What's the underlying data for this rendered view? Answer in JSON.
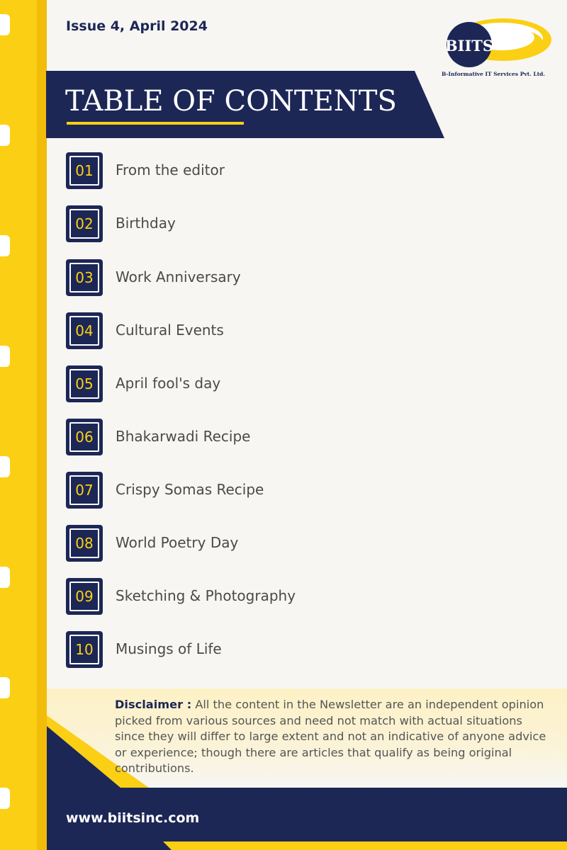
{
  "header": {
    "issue": "Issue 4, April 2024",
    "logo_text": "BIITS",
    "logo_tagline": "B-Informative IT Services Pvt. Ltd."
  },
  "banner": {
    "title": "TABLE OF CONTENTS"
  },
  "toc": [
    {
      "num": "01",
      "label": "From the editor"
    },
    {
      "num": "02",
      "label": "Birthday"
    },
    {
      "num": "03",
      "label": "Work Anniversary"
    },
    {
      "num": "04",
      "label": "Cultural Events"
    },
    {
      "num": "05",
      "label": "April fool's day"
    },
    {
      "num": "06",
      "label": "Bhakarwadi Recipe"
    },
    {
      "num": "07",
      "label": "Crispy Somas Recipe"
    },
    {
      "num": "08",
      "label": "World Poetry Day"
    },
    {
      "num": "09",
      "label": "Sketching & Photography"
    },
    {
      "num": "10",
      "label": "Musings of Life"
    }
  ],
  "disclaimer": {
    "label": "Disclaimer :",
    "text": "All the content in the Newsletter are an independent opinion picked from various sources and need not match with actual situations since they will differ to large extent and not an indicative of anyone advice or experience; though there are articles that qualify as being original contributions."
  },
  "footer": {
    "website": "www.biitsinc.com"
  },
  "colors": {
    "navy": "#1c2756",
    "yellow": "#fbcf14"
  }
}
